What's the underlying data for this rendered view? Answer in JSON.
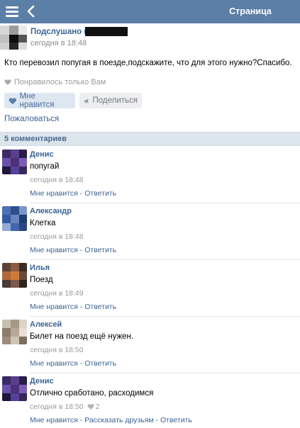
{
  "header": {
    "title": "Страница"
  },
  "post": {
    "author": "Подслушано в",
    "time": "сегодня в 18:48",
    "text": "Кто перевозил попугая в поезде,подскажите, что для этого нужно?Спасибо.",
    "liked_note": "Понравилось только Вам",
    "like_label": "Мне нравится",
    "share_label": "Поделиться",
    "report_label": "Пожаловаться"
  },
  "comments_header": "5 комментариев",
  "comments": [
    {
      "author": "Денис",
      "text": "попугай",
      "time": "сегодня в 18:48",
      "likes": "",
      "like_label": "Мне нравится",
      "sep": " - ",
      "extra_label": "",
      "reply_label": "Ответить",
      "avatar_colors": [
        "#3b2a63",
        "#5a3f8c",
        "#2b1d4a",
        "#6b4fa8",
        "#4a3178",
        "#7a5cb8",
        "#20163a",
        "#55409a",
        "#36265d"
      ]
    },
    {
      "author": "Александр",
      "text": "Клетка",
      "time": "сегодня в 18:48",
      "likes": "",
      "like_label": "Мне нравится",
      "sep": " - ",
      "extra_label": "",
      "reply_label": "Ответить",
      "avatar_colors": [
        "#4e6fb3",
        "#2f4f8e",
        "#7d96c8",
        "#3459a0",
        "#6884bf",
        "#203c75",
        "#94a9d2",
        "#4566a8",
        "#2a4684"
      ]
    },
    {
      "author": "Илья",
      "text": "Поезд",
      "time": "сегодня в 18:49",
      "likes": "",
      "like_label": "Мне нравится",
      "sep": " - ",
      "extra_label": "",
      "reply_label": "Ответить",
      "avatar_colors": [
        "#5c4336",
        "#8a5c40",
        "#3d2c24",
        "#b0683a",
        "#d07a3a",
        "#6a4a38",
        "#4a3a36",
        "#7a5a4a",
        "#2e2420"
      ]
    },
    {
      "author": "Алексей",
      "text": "Билет на поезд ещё нужен.",
      "time": "сегодня в 18:50",
      "likes": "",
      "like_label": "Мне нравится",
      "sep": " - ",
      "extra_label": "",
      "reply_label": "Ответить",
      "avatar_colors": [
        "#c9bfb0",
        "#a89886",
        "#ddd3c6",
        "#8e7c6a",
        "#b7a896",
        "#e8e0d6",
        "#9c8b79",
        "#cfc4b6",
        "#7d6c5c"
      ]
    },
    {
      "author": "Денис",
      "text": "Отлично сработано, расходимся",
      "time": "сегодня в 18:50",
      "likes": "2",
      "like_label": "Мне нравится",
      "sep": " - ",
      "extra_label": "Рассказать друзьям",
      "reply_label": "Ответить",
      "avatar_colors": [
        "#3b2a63",
        "#5a3f8c",
        "#2b1d4a",
        "#6b4fa8",
        "#4a3178",
        "#7a5cb8",
        "#20163a",
        "#55409a",
        "#36265d"
      ]
    }
  ],
  "colors": {
    "header_bg": "#5b7fa6",
    "link": "#3b6394",
    "comments_bar_bg": "#dce4ec"
  },
  "icons": {
    "menu": "menu-icon",
    "back": "back-arrow-icon",
    "heart": "heart-icon",
    "megaphone": "megaphone-icon"
  }
}
